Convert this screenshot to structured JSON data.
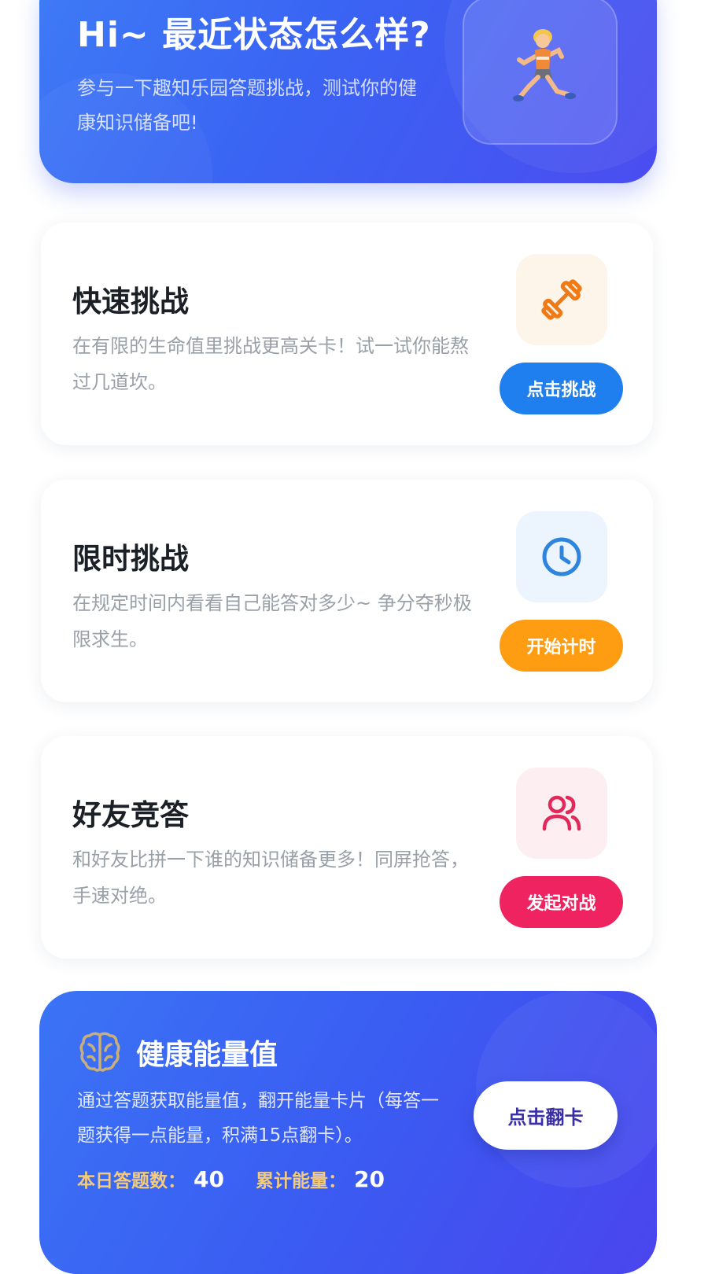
{
  "hero": {
    "title": "Hi~ 最近状态怎么样?",
    "description": "参与一下趣知乐园答题挑战，测试你的健康知识储备吧!",
    "icon": "runner-emoji"
  },
  "challenges": [
    {
      "title": "快速挑战",
      "description": "在有限的生命值里挑战更高关卡！试一试你能熬过几道坎。",
      "button": "点击挑战",
      "icon": "dumbbell-icon",
      "accent": "#1f7fef",
      "icon_bg": "#fdf4ea",
      "icon_color": "#f07a16"
    },
    {
      "title": "限时挑战",
      "description": "在规定时间内看看自己能答对多少~ 争分夺秒极限求生。",
      "button": "开始计时",
      "icon": "clock-icon",
      "accent": "#ff9d12",
      "icon_bg": "#ecf4fd",
      "icon_color": "#2f84dd"
    },
    {
      "title": "好友竞答",
      "description": "和好友比拼一下谁的知识储备更多！同屏抢答，手速对绝。",
      "button": "发起对战",
      "icon": "users-icon",
      "accent": "#ee2360",
      "icon_bg": "#fdeef1",
      "icon_color": "#e02a5c"
    }
  ],
  "energy": {
    "title": "健康能量值",
    "description": "通过答题获取能量值，翻开能量卡片（每答一题获得一点能量，积满15点翻卡）。",
    "button": "点击翻卡",
    "today_label": "本日答题数：",
    "today_value": "40",
    "total_label": "累计能量：",
    "total_value": "20",
    "icon": "brain-icon"
  }
}
